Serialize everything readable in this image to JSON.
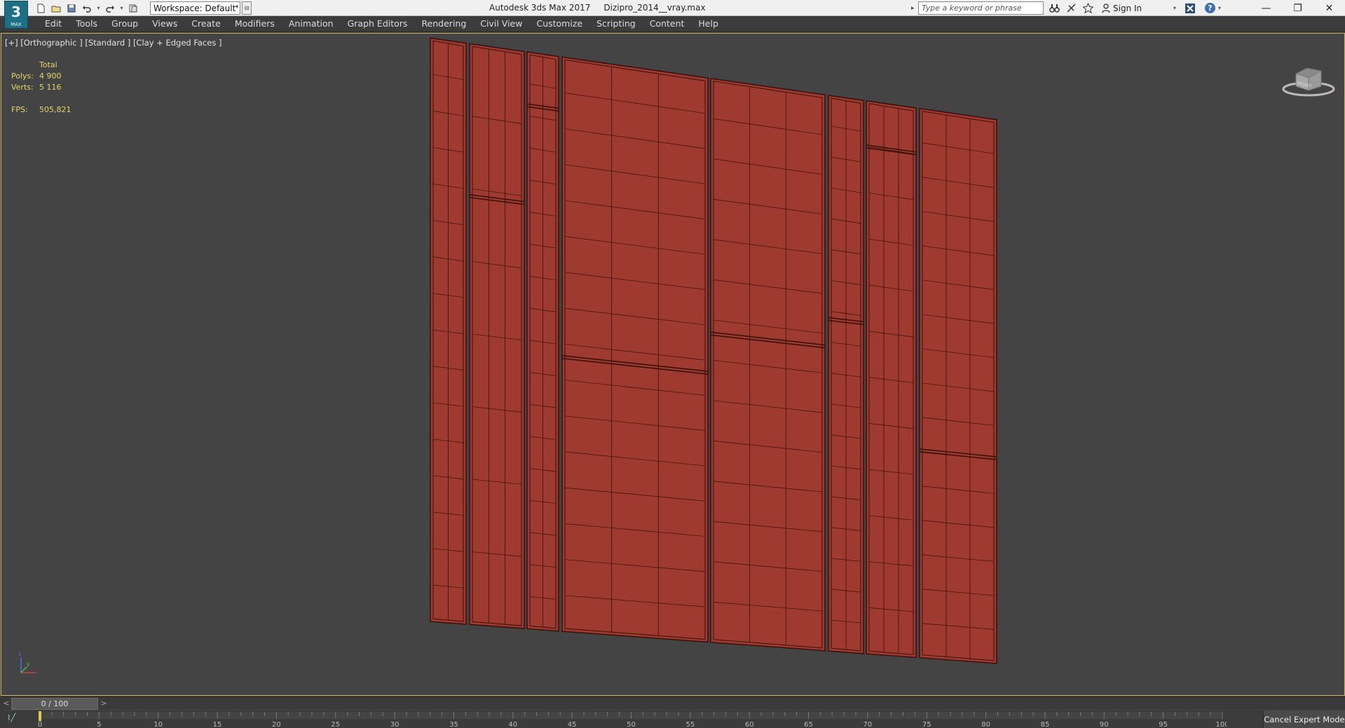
{
  "app": {
    "logo_text": "3",
    "logo_sub": "MAX",
    "title": "Autodesk 3ds Max 2017     Dizipro_2014__vray.max"
  },
  "workspace": {
    "label": "Workspace: Default"
  },
  "search": {
    "placeholder": "Type a keyword or phrase"
  },
  "account": {
    "signin_label": "Sign In"
  },
  "menu": [
    "Edit",
    "Tools",
    "Group",
    "Views",
    "Create",
    "Modifiers",
    "Animation",
    "Graph Editors",
    "Rendering",
    "Civil View",
    "Customize",
    "Scripting",
    "Content",
    "Help"
  ],
  "viewport": {
    "label": "[+] [Orthographic ] [Standard ] [Clay + Edged Faces ]",
    "stats_header": "Total",
    "polys_label": "Polys:",
    "polys_value": "4 900",
    "verts_label": "Verts:",
    "verts_value": "5 116",
    "fps_label": "FPS:",
    "fps_value": "505,821",
    "viewcube_face": "FRONT",
    "model_color": "#9e3a30",
    "edge_color": "#3a100c"
  },
  "timeline": {
    "prev": "<",
    "position": "0 / 100",
    "next": ">",
    "ticks": [
      "0",
      "5",
      "10",
      "15",
      "20",
      "25",
      "30",
      "35",
      "40",
      "45",
      "50",
      "55",
      "60",
      "65",
      "70",
      "75",
      "80",
      "85",
      "90",
      "95",
      "100"
    ]
  },
  "status": {
    "cancel_expert": "Cancel Expert Mode"
  },
  "colors": {
    "accent": "#c8b25c",
    "stats": "#e8d36a",
    "viewport_bg": "#444444"
  }
}
